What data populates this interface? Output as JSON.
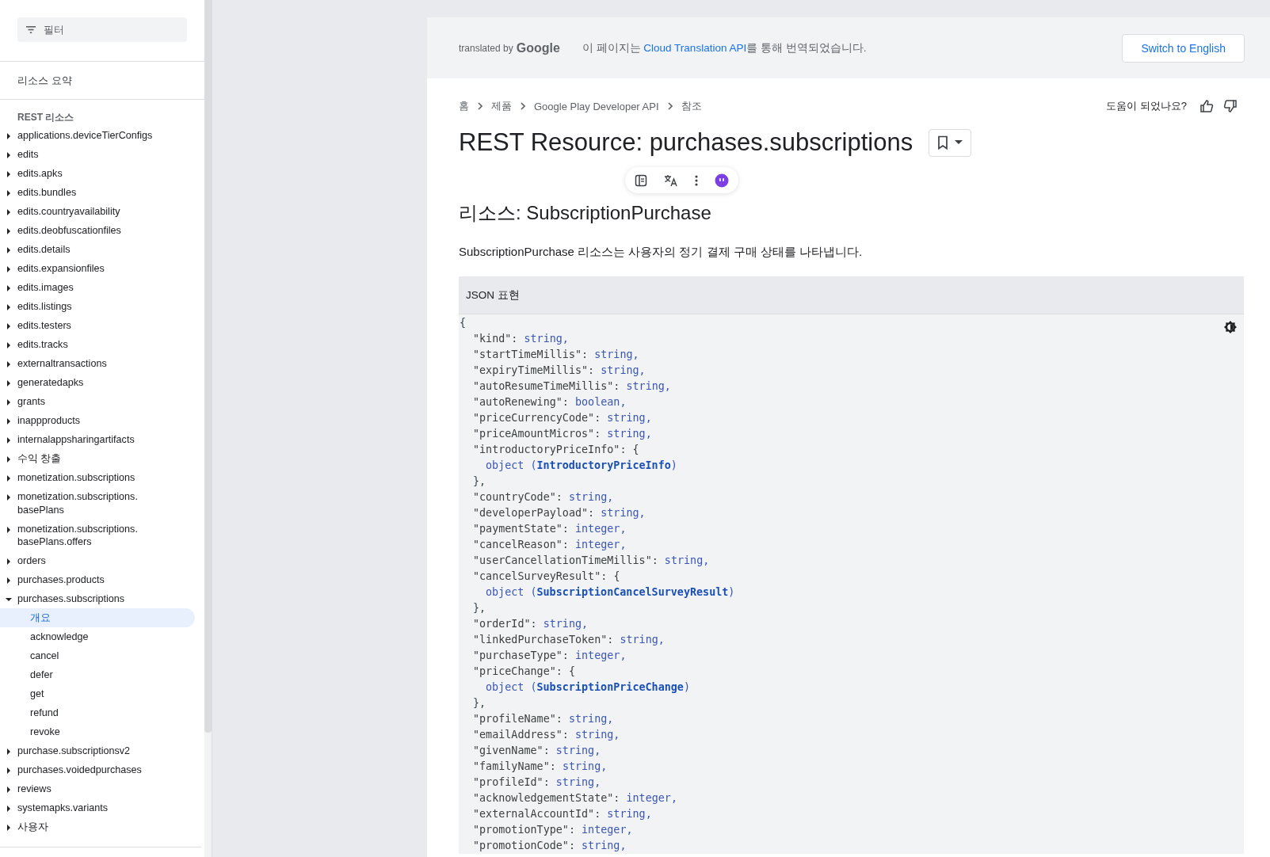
{
  "sidebar": {
    "filter": {
      "placeholder": "필터"
    },
    "summary_link": "리소스 요약",
    "section_title": "REST 리소스",
    "items": [
      {
        "label": "applications.deviceTierConfigs",
        "expanded": false
      },
      {
        "label": "edits",
        "expanded": false
      },
      {
        "label": "edits.apks",
        "expanded": false
      },
      {
        "label": "edits.bundles",
        "expanded": false
      },
      {
        "label": "edits.countryavailability",
        "expanded": false
      },
      {
        "label": "edits.deobfuscationfiles",
        "expanded": false
      },
      {
        "label": "edits.details",
        "expanded": false
      },
      {
        "label": "edits.expansionfiles",
        "expanded": false
      },
      {
        "label": "edits.images",
        "expanded": false
      },
      {
        "label": "edits.listings",
        "expanded": false
      },
      {
        "label": "edits.testers",
        "expanded": false
      },
      {
        "label": "edits.tracks",
        "expanded": false
      },
      {
        "label": "externaltransactions",
        "expanded": false
      },
      {
        "label": "generatedapks",
        "expanded": false
      },
      {
        "label": "grants",
        "expanded": false
      },
      {
        "label": "inappproducts",
        "expanded": false
      },
      {
        "label": "internalappsharingartifacts",
        "expanded": false
      },
      {
        "label": "수익 창출",
        "expanded": false
      },
      {
        "label": "monetization.subscriptions",
        "expanded": false
      },
      {
        "label": "monetization.subscriptions. basePlans",
        "expanded": false
      },
      {
        "label": "monetization.subscriptions. basePlans.offers",
        "expanded": false
      },
      {
        "label": "orders",
        "expanded": false
      },
      {
        "label": "purchases.products",
        "expanded": false
      },
      {
        "label": "purchases.subscriptions",
        "expanded": true,
        "children": [
          {
            "label": "개요",
            "selected": true
          },
          {
            "label": "acknowledge",
            "selected": false
          },
          {
            "label": "cancel",
            "selected": false
          },
          {
            "label": "defer",
            "selected": false
          },
          {
            "label": "get",
            "selected": false
          },
          {
            "label": "refund",
            "selected": false
          },
          {
            "label": "revoke",
            "selected": false
          }
        ]
      },
      {
        "label": "purchase.subscriptionsv2",
        "expanded": false
      },
      {
        "label": "purchases.voidedpurchases",
        "expanded": false
      },
      {
        "label": "reviews",
        "expanded": false
      },
      {
        "label": "systemapks.variants",
        "expanded": false
      },
      {
        "label": "사용자",
        "expanded": false
      }
    ]
  },
  "banner": {
    "translated_by": "translated by",
    "brand": "Google",
    "message_before": "이 페이지는 ",
    "message_link": "Cloud Translation API",
    "message_after": "를 통해 번역되었습니다.",
    "button": "Switch to English"
  },
  "breadcrumbs": [
    "홈",
    "제품",
    "Google Play Developer API",
    "참조"
  ],
  "feedback": {
    "question": "도움이 되었나요?"
  },
  "title": "REST Resource: purchases.subscriptions",
  "heading": "리소스: SubscriptionPurchase",
  "description": "SubscriptionPurchase 리소스는 사용자의 정기 결제 구매 상태를 나타냅니다.",
  "code_block": {
    "header": "JSON 표현",
    "open": "{",
    "lines": [
      {
        "kind": "field",
        "name": "\"kind\": ",
        "type": "string,"
      },
      {
        "kind": "field",
        "name": "\"startTimeMillis\": ",
        "type": "string,"
      },
      {
        "kind": "field",
        "name": "\"expiryTimeMillis\": ",
        "type": "string,"
      },
      {
        "kind": "field",
        "name": "\"autoResumeTimeMillis\": ",
        "type": "string,"
      },
      {
        "kind": "field",
        "name": "\"autoRenewing\": ",
        "type": "boolean,"
      },
      {
        "kind": "field",
        "name": "\"priceCurrencyCode\": ",
        "type": "string,"
      },
      {
        "kind": "field",
        "name": "\"priceAmountMicros\": ",
        "type": "string,"
      },
      {
        "kind": "field",
        "name": "\"introductoryPriceInfo\": ",
        "type": "{",
        "children": [
          {
            "kind": "ref",
            "prefix": "object (",
            "type": "IntroductoryPriceInfo",
            "suffix": ")"
          }
        ],
        "close": "},"
      },
      {
        "kind": "field",
        "name": "\"countryCode\": ",
        "type": "string,"
      },
      {
        "kind": "field",
        "name": "\"developerPayload\": ",
        "type": "string,"
      },
      {
        "kind": "field",
        "name": "\"paymentState\": ",
        "type": "integer,"
      },
      {
        "kind": "field",
        "name": "\"cancelReason\": ",
        "type": "integer,"
      },
      {
        "kind": "field",
        "name": "\"userCancellationTimeMillis\": ",
        "type": "string,"
      },
      {
        "kind": "field",
        "name": "\"cancelSurveyResult\": ",
        "type": "{",
        "children": [
          {
            "kind": "ref",
            "prefix": "object (",
            "type": "SubscriptionCancelSurveyResult",
            "suffix": ")"
          }
        ],
        "close": "},"
      },
      {
        "kind": "field",
        "name": "\"orderId\": ",
        "type": "string,"
      },
      {
        "kind": "field",
        "name": "\"linkedPurchaseToken\": ",
        "type": "string,"
      },
      {
        "kind": "field",
        "name": "\"purchaseType\": ",
        "type": "integer,"
      },
      {
        "kind": "field",
        "name": "\"priceChange\": ",
        "type": "{",
        "children": [
          {
            "kind": "ref",
            "prefix": "object (",
            "type": "SubscriptionPriceChange",
            "suffix": ")"
          }
        ],
        "close": "},"
      },
      {
        "kind": "field",
        "name": "\"profileName\": ",
        "type": "string,"
      },
      {
        "kind": "field",
        "name": "\"emailAddress\": ",
        "type": "string,"
      },
      {
        "kind": "field",
        "name": "\"givenName\": ",
        "type": "string,"
      },
      {
        "kind": "field",
        "name": "\"familyName\": ",
        "type": "string,"
      },
      {
        "kind": "field",
        "name": "\"profileId\": ",
        "type": "string,"
      },
      {
        "kind": "field",
        "name": "\"acknowledgementState\": ",
        "type": "integer,"
      },
      {
        "kind": "field",
        "name": "\"externalAccountId\": ",
        "type": "string,"
      },
      {
        "kind": "field",
        "name": "\"promotionType\": ",
        "type": "integer,"
      },
      {
        "kind": "field",
        "name": "\"promotionCode\": ",
        "type": "string,"
      }
    ]
  }
}
